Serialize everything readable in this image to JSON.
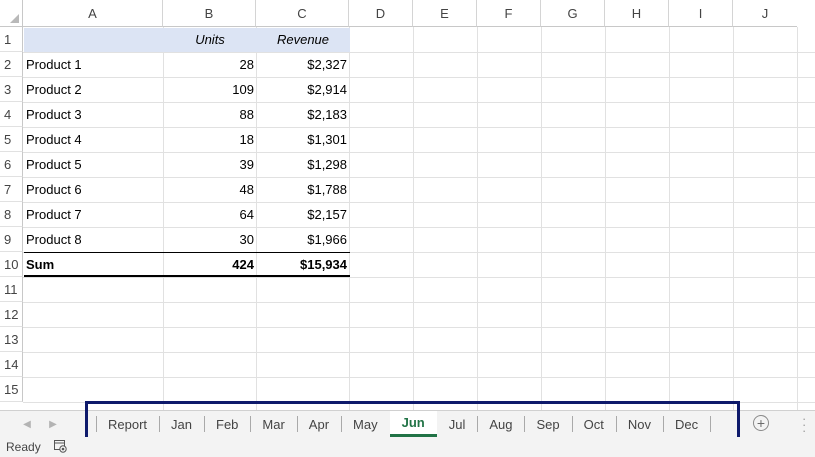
{
  "columns": [
    "A",
    "B",
    "C",
    "D",
    "E",
    "F",
    "G",
    "H",
    "I",
    "J"
  ],
  "rows": [
    "1",
    "2",
    "3",
    "4",
    "5",
    "6",
    "7",
    "8",
    "9",
    "10",
    "11",
    "12",
    "13",
    "14",
    "15"
  ],
  "table": {
    "header": {
      "units": "Units",
      "revenue": "Revenue"
    },
    "products": [
      {
        "name": "Product 1",
        "units": "28",
        "revenue": "$2,327"
      },
      {
        "name": "Product 2",
        "units": "109",
        "revenue": "$2,914"
      },
      {
        "name": "Product 3",
        "units": "88",
        "revenue": "$2,183"
      },
      {
        "name": "Product 4",
        "units": "18",
        "revenue": "$1,301"
      },
      {
        "name": "Product 5",
        "units": "39",
        "revenue": "$1,298"
      },
      {
        "name": "Product 6",
        "units": "48",
        "revenue": "$1,788"
      },
      {
        "name": "Product 7",
        "units": "64",
        "revenue": "$2,157"
      },
      {
        "name": "Product 8",
        "units": "30",
        "revenue": "$1,966"
      }
    ],
    "sum": {
      "label": "Sum",
      "units": "424",
      "revenue": "$15,934"
    },
    "header_fill_color": "#dce4f4"
  },
  "sheet_tabs": [
    "Report",
    "Jan",
    "Feb",
    "Mar",
    "Apr",
    "May",
    "Jun",
    "Jul",
    "Aug",
    "Sep",
    "Oct",
    "Nov",
    "Dec"
  ],
  "active_tab": "Jun",
  "active_tab_color": "#217346",
  "highlight_color": "#0e1a6b",
  "icons": {
    "scroll_left": "triangle-left-icon",
    "scroll_right": "triangle-right-icon",
    "add_sheet": "plus-circle-icon",
    "more": "vertical-ellipsis-icon",
    "macro": "macro-record-icon"
  },
  "status": {
    "ready": "Ready"
  }
}
